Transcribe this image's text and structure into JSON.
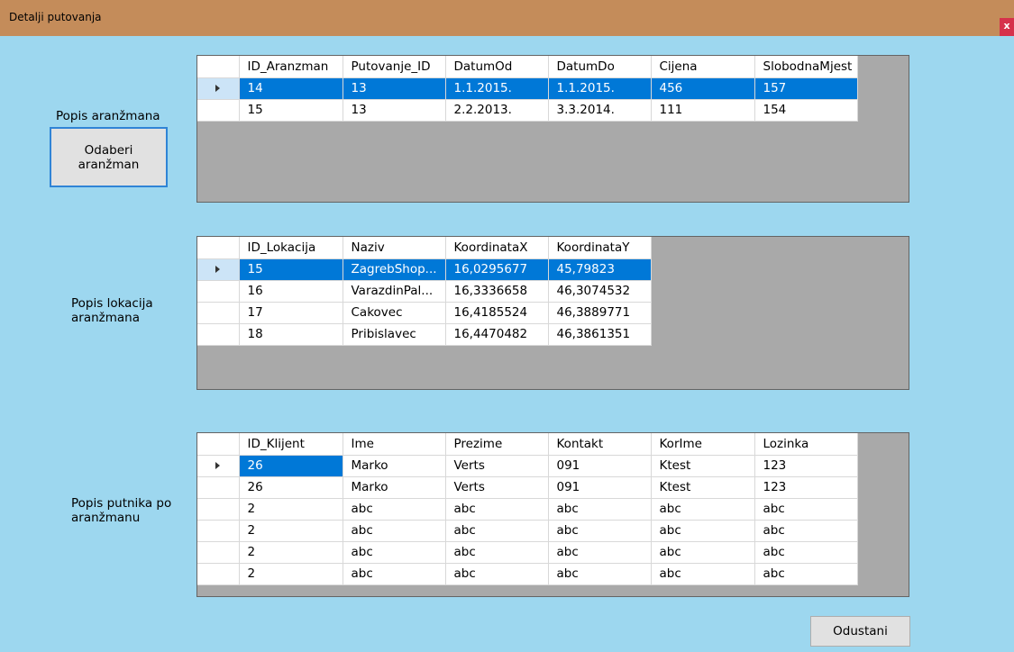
{
  "window": {
    "title": "Detalji putovanja",
    "close_label": "x"
  },
  "aranzmani": {
    "label": "Popis aranžmana",
    "select_button": "Odaberi aranžman",
    "columns": [
      "ID_Aranzman",
      "Putovanje_ID",
      "DatumOd",
      "DatumDo",
      "Cijena",
      "SlobodnaMjest"
    ],
    "rows": [
      [
        "14",
        "13",
        "1.1.2015.",
        "1.1.2015.",
        "456",
        "157"
      ],
      [
        "15",
        "13",
        "2.2.2013.",
        "3.3.2014.",
        "111",
        "154"
      ]
    ]
  },
  "lokacije": {
    "label": "Popis lokacija aranžmana",
    "columns": [
      "ID_Lokacija",
      "Naziv",
      "KoordinataX",
      "KoordinataY"
    ],
    "rows": [
      [
        "15",
        "ZagrebShop...",
        "16,0295677",
        "45,79823"
      ],
      [
        "16",
        "VarazdinPal...",
        "16,3336658",
        "46,3074532"
      ],
      [
        "17",
        "Cakovec",
        "16,4185524",
        "46,3889771"
      ],
      [
        "18",
        "Pribislavec",
        "16,4470482",
        "46,3861351"
      ]
    ]
  },
  "putnici": {
    "label": "Popis putnika po aranžmanu",
    "columns": [
      "ID_Klijent",
      "Ime",
      "Prezime",
      "Kontakt",
      "KorIme",
      "Lozinka"
    ],
    "rows": [
      [
        "26",
        "Marko",
        "Verts",
        "091",
        "Ktest",
        "123"
      ],
      [
        "26",
        "Marko",
        "Verts",
        "091",
        "Ktest",
        "123"
      ],
      [
        "2",
        "abc",
        "abc",
        "abc",
        "abc",
        "abc"
      ],
      [
        "2",
        "abc",
        "abc",
        "abc",
        "abc",
        "abc"
      ],
      [
        "2",
        "abc",
        "abc",
        "abc",
        "abc",
        "abc"
      ],
      [
        "2",
        "abc",
        "abc",
        "abc",
        "abc",
        "abc"
      ]
    ]
  },
  "cancel_button": "Odustani"
}
